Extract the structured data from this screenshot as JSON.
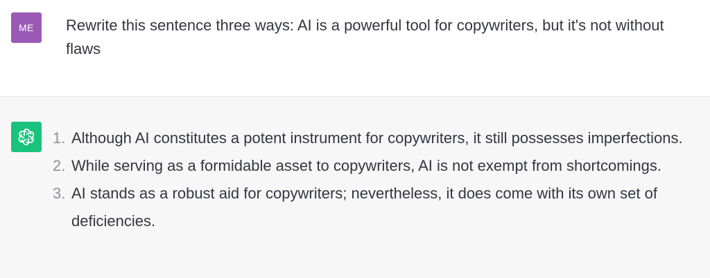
{
  "user": {
    "avatar_initials": "ME",
    "avatar_color": "#9b59b6",
    "message": "Rewrite this sentence three ways: AI is a powerful tool for copywriters, but it's not without flaws"
  },
  "assistant": {
    "avatar_icon": "openai-logo-icon",
    "avatar_color": "#19c37d",
    "items": [
      {
        "number": "1.",
        "text": "Although AI constitutes a potent instrument for copywriters, it still possesses imperfections."
      },
      {
        "number": "2.",
        "text": "While serving as a formidable asset to copywriters, AI is not exempt from shortcomings."
      },
      {
        "number": "3.",
        "text": "AI stands as a robust aid for copywriters; nevertheless, it does come with its own set of deficiencies."
      }
    ]
  }
}
